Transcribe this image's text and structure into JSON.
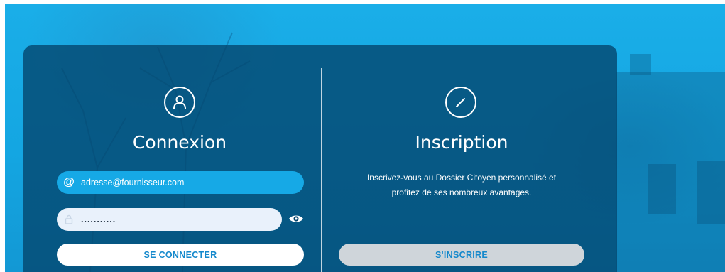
{
  "login": {
    "title": "Connexion",
    "icon": "user-icon",
    "email": {
      "value": "adresse@fournisseur.com",
      "icon": "at-icon"
    },
    "password": {
      "value": "...........",
      "icon": "lock-icon",
      "toggle_icon": "eye-icon"
    },
    "button_label": "SE CONNECTER"
  },
  "signup": {
    "title": "Inscription",
    "icon": "pencil-icon",
    "description": "Inscrivez-vous au Dossier Citoyen personnalisé et profitez de ses nombreux avantages.",
    "button_label": "S'INSCRIRE"
  },
  "colors": {
    "background": "#14a6e2",
    "panel": "#04466e",
    "email_field": "#16a9e6",
    "password_field": "#e9f1fb",
    "button_text": "#1589cc",
    "signup_button": "#cfd5da"
  }
}
